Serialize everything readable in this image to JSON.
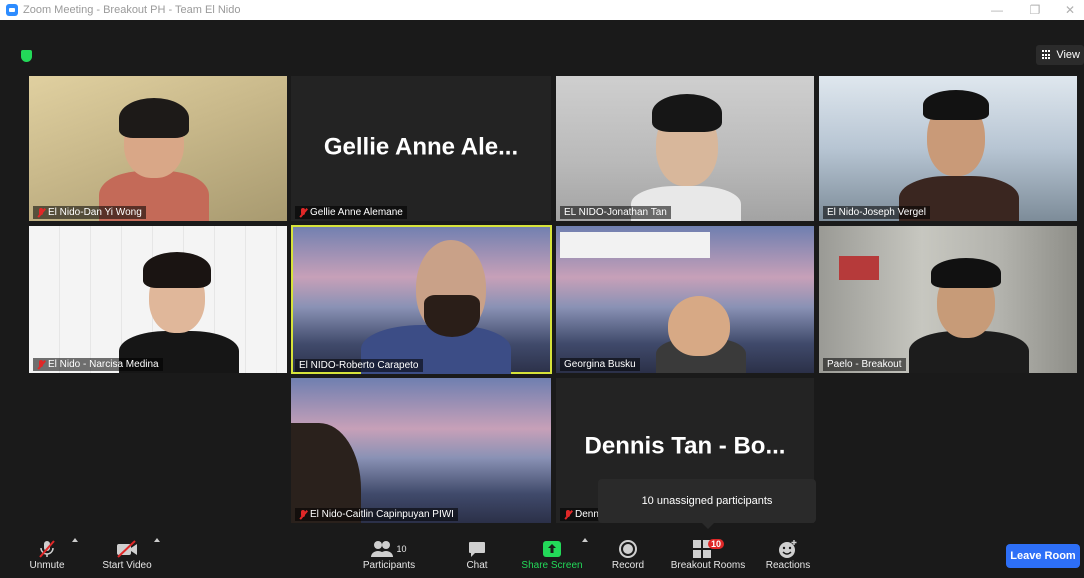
{
  "window": {
    "title": "Zoom Meeting - Breakout PH - Team El Nido"
  },
  "view": {
    "label": "View"
  },
  "tiles": [
    {
      "name": "El Nido-Dan Yi Wong",
      "muted": true
    },
    {
      "name": "Gellie Anne Alemane",
      "muted": true,
      "placeholder": "Gellie Anne Ale..."
    },
    {
      "name": "EL NIDO-Jonathan Tan",
      "muted": false
    },
    {
      "name": "El Nido-Joseph Vergel",
      "muted": false
    },
    {
      "name": "El Nido - Narcisa Medina",
      "muted": true
    },
    {
      "name": "El NIDO-Roberto Carapeto",
      "muted": false,
      "active": true
    },
    {
      "name": "Georgina Busku",
      "muted": false
    },
    {
      "name": "Paelo - Breakout",
      "muted": false
    },
    {
      "name": "El Nido-Caitlin Capinpuyan PIWI",
      "muted": true
    },
    {
      "name": "Denn",
      "muted": true,
      "placeholder": "Dennis Tan - Bo..."
    }
  ],
  "toolbar": {
    "unmute": "Unmute",
    "start_video": "Start Video",
    "participants": "Participants",
    "participants_count": "10",
    "chat": "Chat",
    "share_screen": "Share Screen",
    "record": "Record",
    "breakout_rooms": "Breakout Rooms",
    "breakout_badge": "10",
    "reactions": "Reactions",
    "leave_room": "Leave Room"
  },
  "tooltip": {
    "text": "10 unassigned participants"
  },
  "colors": {
    "accent": "#2d6ff7",
    "share_green": "#23d959",
    "muted_red": "#e02828",
    "active_speaker": "#d7e33a"
  }
}
